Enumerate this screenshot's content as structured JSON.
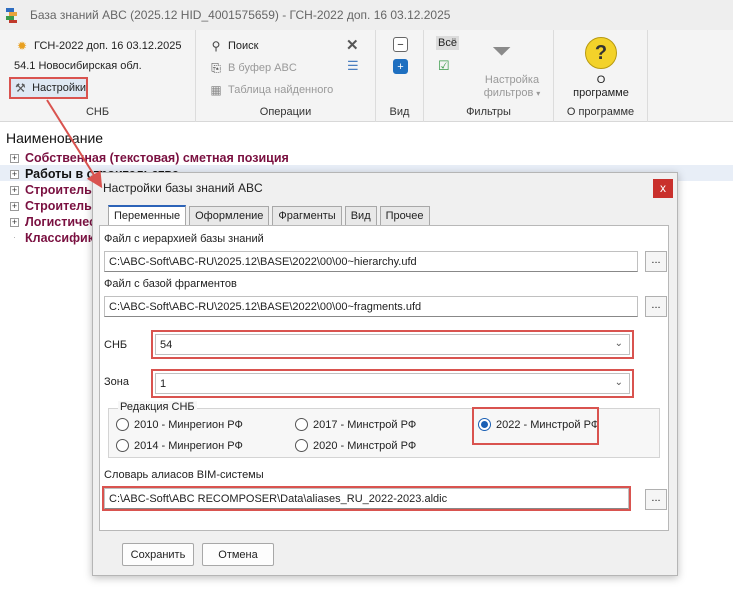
{
  "window": {
    "title": "База знаний ABC (2025.12 HID_4001575659) - ГСН-2022 доп. 16 03.12.2025"
  },
  "ribbon": {
    "snb": {
      "collection": "ГСН-2022 доп. 16 03.12.2025",
      "region": "54.1 Новосибирская обл.",
      "settings_label": "Настройки",
      "group_label": "СНБ"
    },
    "operations": {
      "search": "Поиск",
      "copy_buffer": "В буфер ABC",
      "found_table": "Таблица найденного",
      "group_label": "Операции"
    },
    "view": {
      "group_label": "Вид"
    },
    "filters": {
      "all_label": "Всё",
      "filter_settings_line1": "Настройка",
      "filter_settings_line2": "фильтров",
      "group_label": "Фильтры"
    },
    "about": {
      "label_line1": "О",
      "label_line2": "программе",
      "group_label": "О программе"
    }
  },
  "tree": {
    "header": "Наименование",
    "items": [
      {
        "label": "Собственная (текстовая) сметная позиция"
      },
      {
        "label": "Работы в строительстве"
      },
      {
        "label": "Строительные ресурсы"
      },
      {
        "label": "Строительные машины"
      },
      {
        "label": "Логистические затраты"
      },
      {
        "label": "Классификаторы"
      }
    ]
  },
  "dialog": {
    "title": "Настройки базы знаний ABC",
    "close": "x",
    "tabs": [
      {
        "label": "Переменные",
        "active": true
      },
      {
        "label": "Оформление",
        "active": false
      },
      {
        "label": "Фрагменты",
        "active": false
      },
      {
        "label": "Вид",
        "active": false
      },
      {
        "label": "Прочее",
        "active": false
      }
    ],
    "hierarchy_label": "Файл с иерархией базы знаний",
    "hierarchy_value": "C:\\ABC-Soft\\ABC-RU\\2025.12\\BASE\\2022\\00\\00~hierarchy.ufd",
    "fragments_label": "Файл с базой фрагментов",
    "fragments_value": "C:\\ABC-Soft\\ABC-RU\\2025.12\\BASE\\2022\\00\\00~fragments.ufd",
    "browse": "...",
    "snb_label": "СНБ",
    "snb_value": "54",
    "zone_label": "Зона",
    "zone_value": "1",
    "edition_label": "Редакция СНБ",
    "editions": [
      {
        "label": "2010 - Минрегион РФ",
        "selected": false
      },
      {
        "label": "2017 - Минстрой РФ",
        "selected": false
      },
      {
        "label": "2022 - Минстрой РФ",
        "selected": true
      },
      {
        "label": "2014 - Минрегион РФ",
        "selected": false
      },
      {
        "label": "2020 - Минстрой РФ",
        "selected": false
      }
    ],
    "bim_label": "Словарь алиасов BIM-системы",
    "bim_value": "C:\\ABC-Soft\\ABC RECOMPOSER\\Data\\aliases_RU_2022-2023.aldic",
    "save": "Сохранить",
    "cancel": "Отмена"
  },
  "colors": {
    "highlight": "#d9534f",
    "tree_text": "#7a1040",
    "accent": "#2c63b8"
  }
}
